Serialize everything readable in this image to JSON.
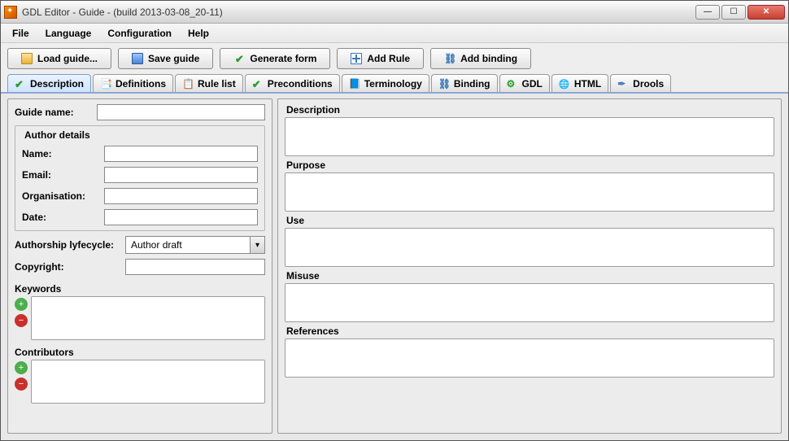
{
  "window": {
    "title": "GDL Editor - Guide - (build 2013-03-08_20-11)"
  },
  "menubar": [
    "File",
    "Language",
    "Configuration",
    "Help"
  ],
  "toolbar": {
    "load": "Load guide...",
    "save": "Save guide",
    "generate": "Generate form",
    "addRule": "Add Rule",
    "addBinding": "Add binding"
  },
  "tabs": {
    "description": "Description",
    "definitions": "Definitions",
    "ruleList": "Rule list",
    "preconditions": "Preconditions",
    "terminology": "Terminology",
    "binding": "Binding",
    "gdl": "GDL",
    "html": "HTML",
    "drools": "Drools"
  },
  "left": {
    "guideNameLabel": "Guide name:",
    "guideName": "",
    "authorDetailsTitle": "Author details",
    "nameLabel": "Name:",
    "name": "",
    "emailLabel": "Email:",
    "email": "",
    "orgLabel": "Organisation:",
    "organisation": "",
    "dateLabel": "Date:",
    "date": "",
    "lifecycleLabel": "Authorship lyfecycle:",
    "lifecycleValue": "Author draft",
    "copyrightLabel": "Copyright:",
    "copyright": "",
    "keywordsLabel": "Keywords",
    "contributorsLabel": "Contributors"
  },
  "right": {
    "description": {
      "label": "Description",
      "value": ""
    },
    "purpose": {
      "label": "Purpose",
      "value": ""
    },
    "use": {
      "label": "Use",
      "value": ""
    },
    "misuse": {
      "label": "Misuse",
      "value": ""
    },
    "references": {
      "label": "References",
      "value": ""
    }
  }
}
